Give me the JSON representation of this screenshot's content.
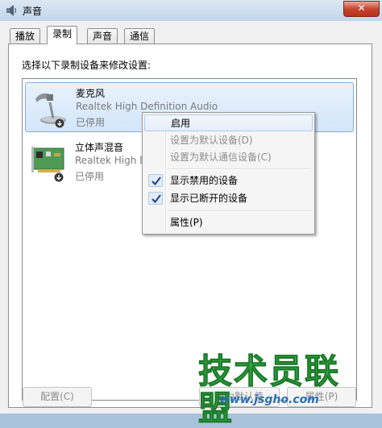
{
  "window": {
    "title": "声音",
    "close_glyph": "✕"
  },
  "tabs": [
    {
      "label": "播放",
      "active": false
    },
    {
      "label": "录制",
      "active": true
    },
    {
      "label": "声音",
      "active": false
    },
    {
      "label": "通信",
      "active": false
    }
  ],
  "instruction": "选择以下录制设备来修改设置:",
  "devices": [
    {
      "name": "麦克风",
      "driver": "Realtek High Definition Audio",
      "status": "已停用",
      "icon": "microphone-icon",
      "selected": true
    },
    {
      "name": "立体声混音",
      "driver": "Realtek High Definition Audio",
      "status": "已停用",
      "icon": "sound-card-icon",
      "selected": false
    }
  ],
  "buttons": {
    "configure": "配置(C)",
    "set_default": "设为默认值",
    "properties": "属性(P)"
  },
  "context_menu": {
    "items": [
      {
        "label": "启用",
        "enabled": true,
        "checked": false,
        "hover": true
      },
      {
        "label": "设置为默认设备(D)",
        "enabled": false,
        "checked": false
      },
      {
        "label": "设置为默认通信设备(C)",
        "enabled": false,
        "checked": false
      },
      {
        "label": "显示禁用的设备",
        "enabled": true,
        "checked": true
      },
      {
        "label": "显示已断开的设备",
        "enabled": true,
        "checked": true
      },
      {
        "label": "属性(P)",
        "enabled": true,
        "checked": false
      }
    ]
  },
  "watermark": {
    "title": "技术员联盟",
    "url": "www.jsgho.com"
  },
  "colors": {
    "accent": "#3399ff",
    "selection_border": "#84acdd",
    "watermark_green": "#39b54a",
    "watermark_blue": "#2a6fb5"
  }
}
